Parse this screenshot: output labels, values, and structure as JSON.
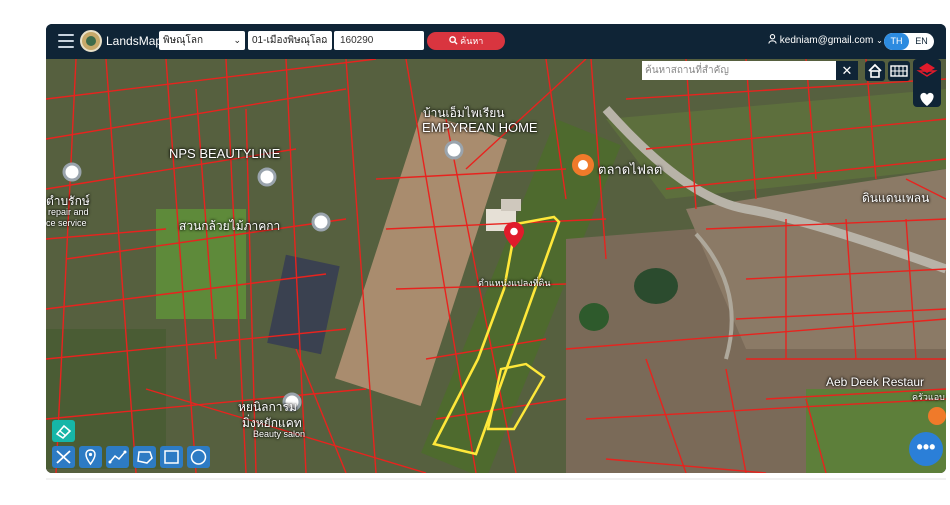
{
  "header": {
    "brand": "LandsMaps",
    "province_select": "พิษณุโลก",
    "district_select": "01-เมืองพิษณุโลก",
    "parcel_input": "160290",
    "search_button": "ค้นหา",
    "user_email": "kedniam@gmail.com",
    "lang_th": "TH",
    "lang_en": "EN"
  },
  "map": {
    "place_search_placeholder": "ค้นหาสถานที่สำคัญ",
    "close_label": "✕",
    "labels": [
      "บ้านเอ็มไพเรียน",
      "EMPYREAN HOME",
      "NPS BEAUTYLINE",
      "ตำบรักษ์",
      "repair and",
      "ce service",
      "สวนกล้วยไม้ภาคกา",
      "ตำแหน่งแปลงที่ดิน",
      "ตลาดไฟลต",
      "ดินแดนเพลน",
      "Aeb Deek Restaur",
      "ครัวแอบ",
      "หยนิลการม",
      "มิ่งหยักแคท",
      "Beauty salon"
    ],
    "fab_label": "•••"
  },
  "icons": {
    "search": "search-icon",
    "user": "user-icon",
    "home": "home-icon",
    "grid": "grid-icon",
    "layers": "layers-icon",
    "favorite": "heart-icon",
    "eraser": "eraser-icon",
    "measure": "ruler-icon",
    "pin": "map-pin-icon",
    "line": "polyline-icon",
    "polygon": "polygon-icon",
    "rectangle": "rectangle-icon",
    "circle": "circle-icon"
  },
  "colors": {
    "topbar": "#0f2436",
    "accent_red": "#d9353f",
    "parcel_red": "#e8231e",
    "selected_yellow": "#ffe83a",
    "tool_blue": "#2d7bc4"
  }
}
